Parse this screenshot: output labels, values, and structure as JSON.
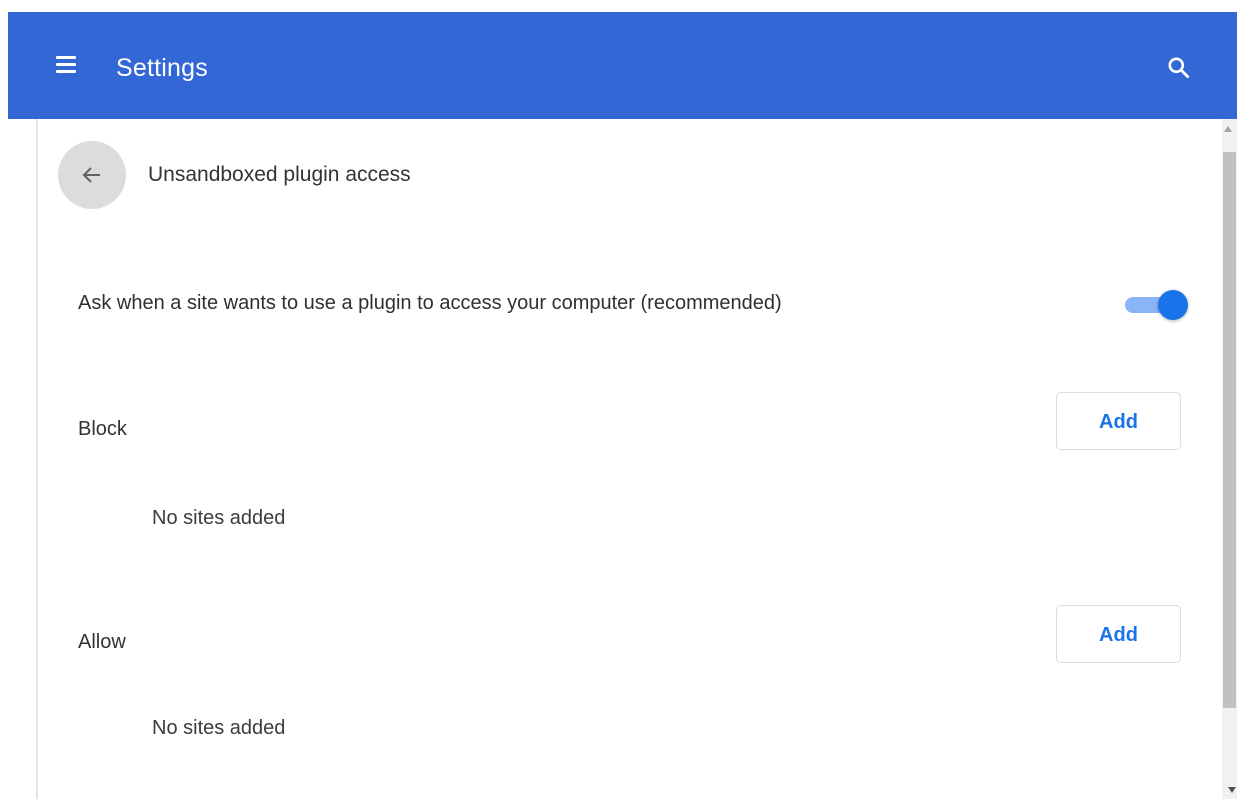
{
  "header": {
    "title": "Settings",
    "menu_icon": "hamburger-menu-icon",
    "search_icon": "search-icon",
    "color": "#3367d6"
  },
  "subpage": {
    "back_icon": "arrow-back-icon",
    "title": "Unsandboxed plugin access"
  },
  "ask_setting": {
    "label": "Ask when a site wants to use a plugin to access your computer (recommended)",
    "enabled": true,
    "accent": "#1a73e8"
  },
  "sections": {
    "block": {
      "label": "Block",
      "add_label": "Add",
      "empty_text": "No sites added"
    },
    "allow": {
      "label": "Allow",
      "add_label": "Add",
      "empty_text": "No sites added"
    }
  }
}
